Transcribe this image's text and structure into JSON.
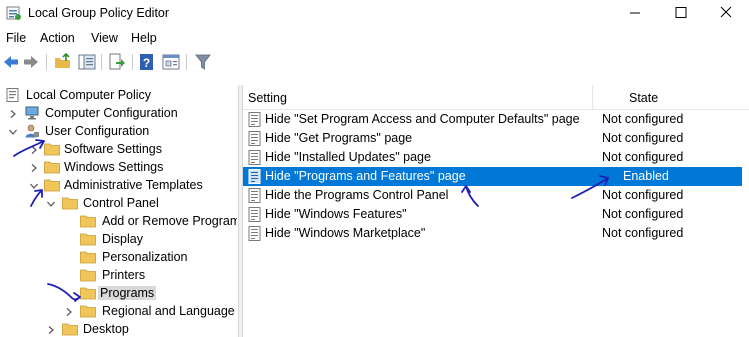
{
  "window": {
    "title": "Local Group Policy Editor",
    "minimize_glyph": "—",
    "maximize_glyph": "☐",
    "close_glyph": "✕"
  },
  "menu": [
    "File",
    "Action",
    "View",
    "Help"
  ],
  "toolbar": {
    "icons": [
      "back-arrow-icon",
      "forward-arrow-icon",
      "up-folder-icon",
      "show-hide-tree-icon",
      "export-list-icon",
      "help-icon",
      "properties-icon",
      "filter-icon"
    ]
  },
  "tree": {
    "items": [
      {
        "label": "Local Computer Policy"
      },
      {
        "label": "Computer Configuration"
      },
      {
        "label": "User Configuration"
      },
      {
        "label": "Software Settings"
      },
      {
        "label": "Windows Settings"
      },
      {
        "label": "Administrative Templates"
      },
      {
        "label": "Control Panel"
      },
      {
        "label": "Add or Remove Programs"
      },
      {
        "label": "Display"
      },
      {
        "label": "Personalization"
      },
      {
        "label": "Printers"
      },
      {
        "label": "Programs"
      },
      {
        "label": "Regional and Language Options"
      },
      {
        "label": "Desktop"
      }
    ],
    "selected": "Programs"
  },
  "list": {
    "columns": {
      "setting": "Setting",
      "state": "State"
    },
    "rows": [
      {
        "setting": "Hide \"Set Program Access and Computer Defaults\" page",
        "state": "Not configured"
      },
      {
        "setting": "Hide \"Get Programs\" page",
        "state": "Not configured"
      },
      {
        "setting": "Hide \"Installed Updates\" page",
        "state": "Not configured"
      },
      {
        "setting": "Hide \"Programs and Features\" page",
        "state": "Enabled"
      },
      {
        "setting": "Hide the Programs Control Panel",
        "state": "Not configured"
      },
      {
        "setting": "Hide \"Windows Features\"",
        "state": "Not configured"
      },
      {
        "setting": "Hide \"Windows Marketplace\"",
        "state": "Not configured"
      }
    ],
    "selected_setting": "Hide \"Programs and Features\" page"
  },
  "colors": {
    "selection": "#0078d7",
    "annotation_ink": "#1f1fb8",
    "folder": "#f0c65b"
  }
}
